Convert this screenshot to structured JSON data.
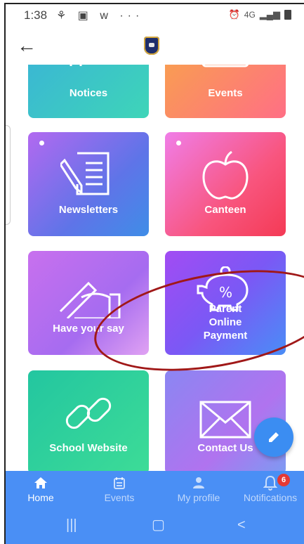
{
  "status_bar": {
    "time": "1:38",
    "left_icons": "⚘ ▣ w ···",
    "network": "4G"
  },
  "app_bar": {
    "back_icon": "arrow-left-icon",
    "logo": "school-crest-logo"
  },
  "tiles": [
    {
      "label": "Notices",
      "icon": "pin-icon"
    },
    {
      "label": "Events",
      "icon": "calendar-icon"
    },
    {
      "label": "Newsletters",
      "icon": "document-pencil-icon"
    },
    {
      "label": "Canteen",
      "icon": "apple-icon"
    },
    {
      "label": "Have your say",
      "icon": "hand-writing-icon"
    },
    {
      "label": "Parent Online Payment",
      "icon": "piggy-bank-icon"
    },
    {
      "label": "School Website",
      "icon": "link-icon"
    },
    {
      "label": "Contact Us",
      "icon": "envelope-icon"
    }
  ],
  "fab": {
    "icon": "pencil-icon"
  },
  "bottom_nav": [
    {
      "label": "Home",
      "active": true
    },
    {
      "label": "Events",
      "active": false
    },
    {
      "label": "My profile",
      "active": false
    },
    {
      "label": "Notifications",
      "active": false,
      "badge": "6"
    }
  ],
  "colors": {
    "nav_blue": "#4a8ff5",
    "annotation_red": "#a01818",
    "badge_red": "#e53935"
  }
}
